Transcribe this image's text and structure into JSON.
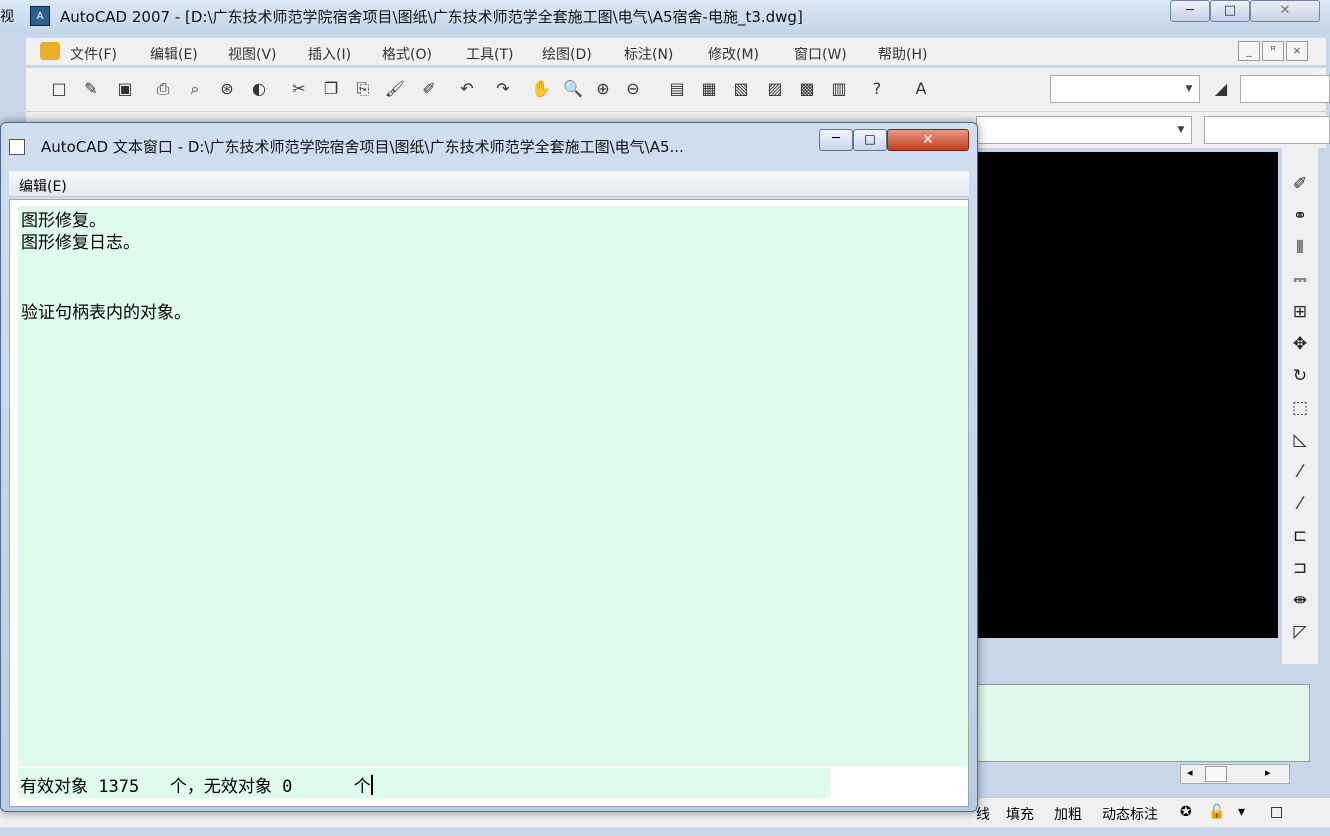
{
  "main_window": {
    "title": "AutoCAD 2007 - [D:\\广东技术师范学院宿舍项目\\图纸\\广东技术师范学全套施工图\\电气\\A5宿舍-电施_t3.dwg]",
    "left_edge_char": "视",
    "app_icon": "autocad-icon",
    "controls": {
      "min": "─",
      "max": "□",
      "close": "✕"
    }
  },
  "menu": {
    "items": [
      "文件(F)",
      "编辑(E)",
      "视图(V)",
      "插入(I)",
      "格式(O)",
      "工具(T)",
      "绘图(D)",
      "标注(N)",
      "修改(M)",
      "窗口(W)",
      "帮助(H)"
    ],
    "mdi_controls": [
      "_",
      "ꟸ",
      "×"
    ]
  },
  "toolbar": {
    "icons": [
      {
        "name": "new-icon",
        "glyph": "□"
      },
      {
        "name": "open-icon",
        "glyph": "✎"
      },
      {
        "name": "save-icon",
        "glyph": "▣"
      },
      {
        "name": "plot-icon",
        "glyph": "⎙"
      },
      {
        "name": "plot-preview-icon",
        "glyph": "⌕"
      },
      {
        "name": "publish-icon",
        "glyph": "⊛"
      },
      {
        "name": "3d-dwf-icon",
        "glyph": "◐"
      },
      {
        "name": "cut-icon",
        "glyph": "✂"
      },
      {
        "name": "copy-icon",
        "glyph": "❐"
      },
      {
        "name": "paste-icon",
        "glyph": "⎘"
      },
      {
        "name": "match-properties-icon",
        "glyph": "🖌"
      },
      {
        "name": "block-editor-icon",
        "glyph": "✐"
      },
      {
        "name": "undo-icon",
        "glyph": "↶"
      },
      {
        "name": "redo-icon",
        "glyph": "↷"
      },
      {
        "name": "pan-icon",
        "glyph": "✋"
      },
      {
        "name": "zoom-realtime-icon",
        "glyph": "🔍"
      },
      {
        "name": "zoom-window-icon",
        "glyph": "⊕"
      },
      {
        "name": "zoom-previous-icon",
        "glyph": "⊖"
      },
      {
        "name": "properties-icon",
        "glyph": "▤"
      },
      {
        "name": "design-center-icon",
        "glyph": "▦"
      },
      {
        "name": "tool-palettes-icon",
        "glyph": "▧"
      },
      {
        "name": "sheet-set-icon",
        "glyph": "▨"
      },
      {
        "name": "markup-icon",
        "glyph": "▩"
      },
      {
        "name": "calculator-icon",
        "glyph": "▥"
      },
      {
        "name": "help-icon",
        "glyph": "?"
      },
      {
        "name": "text-style-icon",
        "glyph": "A"
      },
      {
        "name": "dim-style-icon",
        "glyph": "◢"
      }
    ]
  },
  "modify_toolbar": {
    "icons": [
      {
        "name": "erase-icon",
        "glyph": "✐"
      },
      {
        "name": "copy-object-icon",
        "glyph": "⚭"
      },
      {
        "name": "mirror-icon",
        "glyph": "⫴"
      },
      {
        "name": "offset-icon",
        "glyph": "⎓"
      },
      {
        "name": "array-icon",
        "glyph": "⊞"
      },
      {
        "name": "move-icon",
        "glyph": "✥"
      },
      {
        "name": "rotate-icon",
        "glyph": "↻"
      },
      {
        "name": "scale-icon",
        "glyph": "⬚"
      },
      {
        "name": "stretch-icon",
        "glyph": "◺"
      },
      {
        "name": "trim-icon",
        "glyph": "⁄"
      },
      {
        "name": "extend-icon",
        "glyph": "⁄"
      },
      {
        "name": "break-icon",
        "glyph": "⊏"
      },
      {
        "name": "break-at-point-icon",
        "glyph": "⊐"
      },
      {
        "name": "join-icon",
        "glyph": "⇼"
      },
      {
        "name": "chamfer-icon",
        "glyph": "◸"
      }
    ]
  },
  "status_bar": {
    "items": [
      "线",
      "填充",
      "加粗",
      "动态标注"
    ],
    "icons": [
      {
        "name": "communication-center-icon",
        "glyph": "✪"
      },
      {
        "name": "lock-icon",
        "glyph": "🔓"
      },
      {
        "name": "dropdown-icon",
        "glyph": "▾"
      },
      {
        "name": "clean-screen-icon",
        "glyph": "□"
      }
    ]
  },
  "scrollbar": {
    "left": "◂",
    "right": "▸"
  },
  "text_window": {
    "title": "AutoCAD 文本窗口 - D:\\广东技术师范学院宿舍项目\\图纸\\广东技术师范学全套施工图\\电气\\A5...",
    "controls": {
      "min": "─",
      "max": "□",
      "close": "✕"
    },
    "menu_edit": "编辑(E)",
    "lines": [
      "图形修复。",
      "图形修复日志。",
      "",
      "",
      "验证句柄表内的对象。"
    ],
    "input_line": "有效对象 1375   个，无效对象 0      个"
  }
}
